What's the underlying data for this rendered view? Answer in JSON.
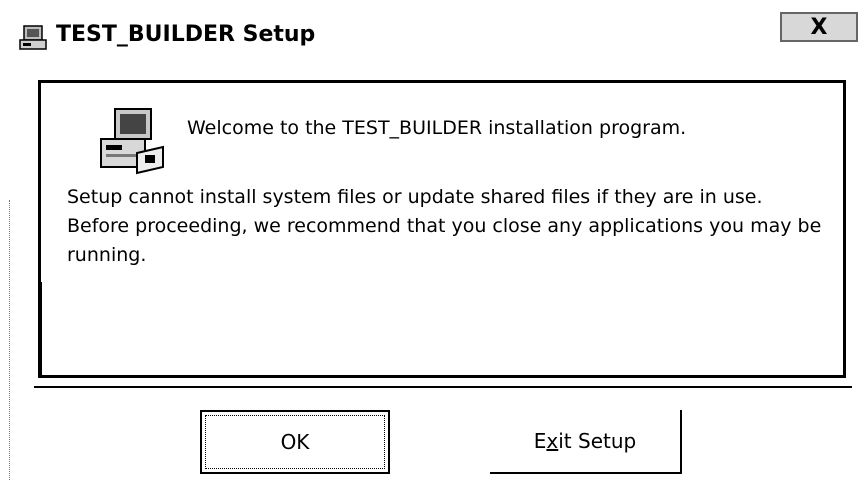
{
  "window": {
    "title": "TEST_BUILDER Setup",
    "close_label": "X"
  },
  "content": {
    "welcome": "Welcome to the TEST_BUILDER installation program.",
    "message": "Setup cannot install system files or update shared files if they are in use. Before proceeding, we recommend that you close any applications you may be running."
  },
  "buttons": {
    "ok_label": "OK",
    "exit_label_pre": "E",
    "exit_label_acc": "x",
    "exit_label_post": "it Setup"
  },
  "icons": {
    "title": "setup-computer-icon",
    "welcome": "setup-computer-icon"
  }
}
